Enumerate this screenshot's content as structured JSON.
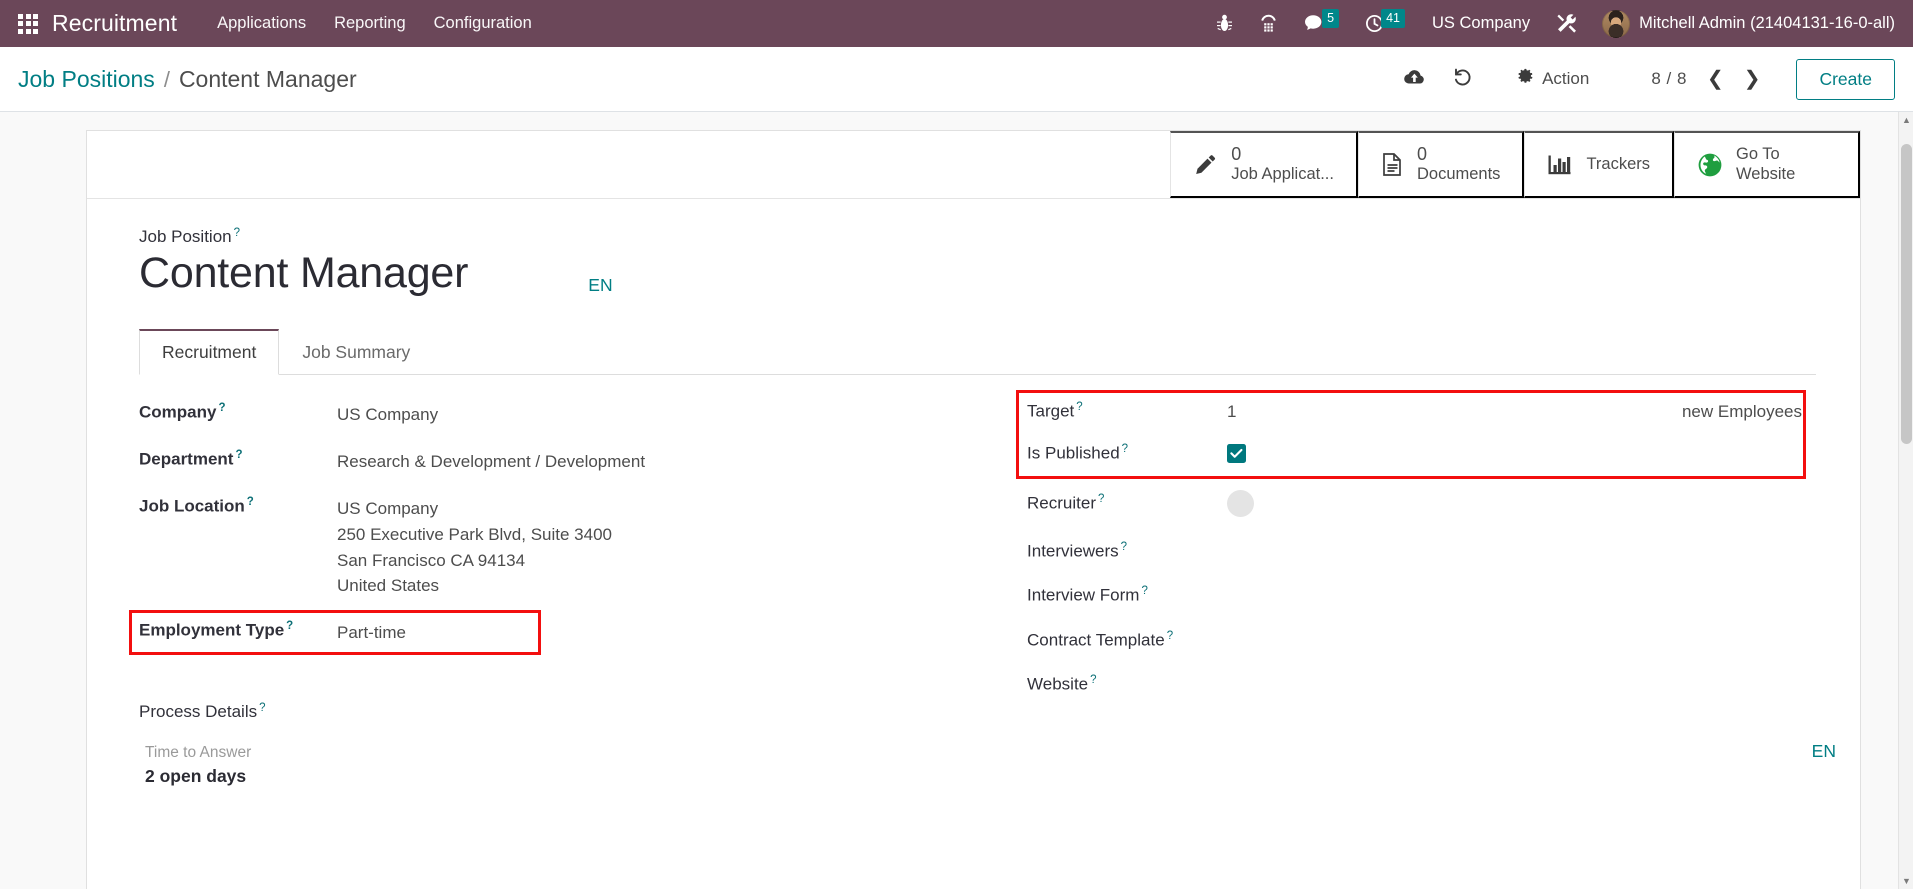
{
  "navbar": {
    "apps_icon": "apps-grid-icon",
    "brand": "Recruitment",
    "menu_items": [
      {
        "label": "Applications"
      },
      {
        "label": "Reporting"
      },
      {
        "label": "Configuration"
      }
    ],
    "icons": [
      {
        "name": "bug-icon",
        "badge": ""
      },
      {
        "name": "voip-dialpad-icon",
        "badge": ""
      },
      {
        "name": "messages-icon",
        "badge": "5"
      },
      {
        "name": "activities-clock-icon",
        "badge": "41"
      }
    ],
    "company": "US Company",
    "tools_icon": "tools-wrench-icon",
    "user": "Mitchell Admin (21404131-16-0-all)",
    "accent": "#6b4759",
    "badge_color": "#00878a"
  },
  "control_panel": {
    "breadcrumb_root": "Job Positions",
    "breadcrumb_sep": "/",
    "breadcrumb_current": "Content Manager",
    "save_icon": "cloud-upload-icon",
    "discard_icon": "undo-arrow-icon",
    "action_label": "Action",
    "action_icon": "gear-icon",
    "pager": "8 / 8",
    "prev_icon": "chevron-left-icon",
    "next_icon": "chevron-right-icon",
    "create_label": "Create",
    "link_color": "#017e84"
  },
  "stat_buttons": [
    {
      "icon": "pencil-icon",
      "value": "0",
      "label": "Job Applicat..."
    },
    {
      "icon": "document-icon",
      "value": "0",
      "label": "Documents"
    },
    {
      "icon": "bar-chart-icon",
      "value": "",
      "label": "Trackers"
    },
    {
      "icon": "globe-icon",
      "value": "",
      "label": "Go To Website"
    }
  ],
  "form": {
    "title_field_label": "Job Position",
    "title_value": "Content Manager",
    "lang_badge": "EN",
    "tabs": [
      {
        "label": "Recruitment",
        "active": true
      },
      {
        "label": "Job Summary",
        "active": false
      }
    ],
    "left_fields": [
      {
        "label": "Company",
        "value": "US Company"
      },
      {
        "label": "Department",
        "value": "Research & Development / Development"
      },
      {
        "label": "Job Location",
        "value": "US Company\n250 Executive Park Blvd, Suite 3400\nSan Francisco CA 94134\nUnited States"
      },
      {
        "label": "Employment Type",
        "value": "Part-time",
        "highlighted": true
      }
    ],
    "job_location_lines": [
      "US Company",
      "250 Executive Park Blvd, Suite 3400",
      "San Francisco CA 94134",
      "United States"
    ],
    "right_fields": [
      {
        "label": "Target",
        "value": "1",
        "suffix": "new Employees",
        "type": "number",
        "highlighted": true
      },
      {
        "label": "Is Published",
        "value": "",
        "type": "checkbox",
        "checked": true,
        "highlighted": true
      },
      {
        "label": "Recruiter",
        "value": "",
        "type": "avatar"
      },
      {
        "label": "Interviewers",
        "value": "",
        "type": "tags"
      },
      {
        "label": "Interview Form",
        "value": "",
        "type": "many2one"
      },
      {
        "label": "Contract Template",
        "value": "",
        "type": "many2one"
      },
      {
        "label": "Website",
        "value": "",
        "type": "many2one"
      }
    ],
    "process_details": {
      "label": "Process Details",
      "sub_label": "Time to Answer",
      "value": "2 open days"
    },
    "lang_badge_bottom": "EN",
    "highlight_color": "#f30f0f",
    "checkbox_color": "#00787e"
  }
}
